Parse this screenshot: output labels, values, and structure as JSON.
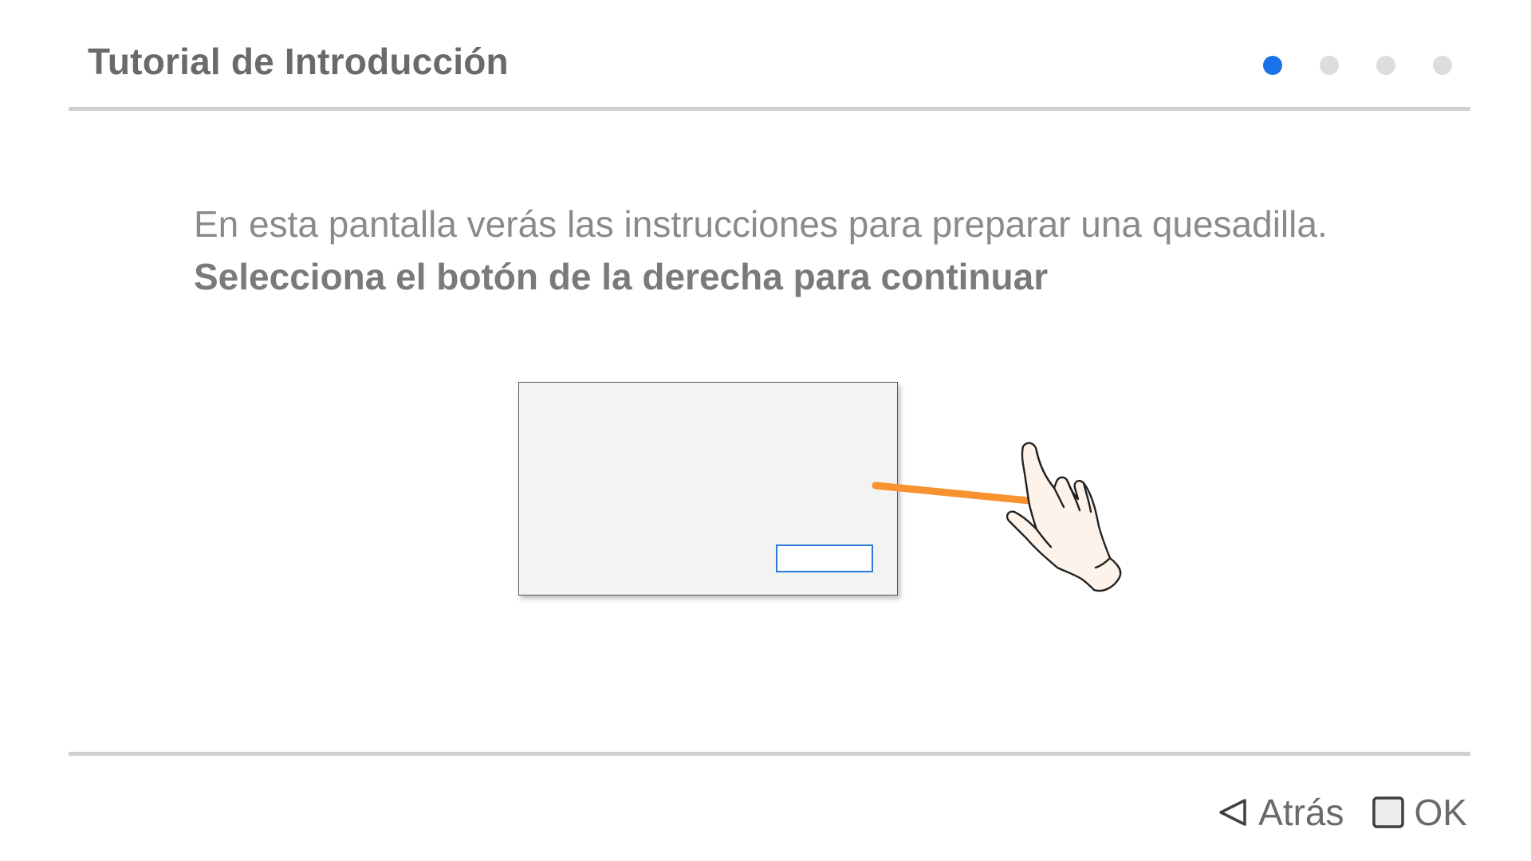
{
  "header": {
    "title": "Tutorial de Introducción",
    "steps": {
      "total": 4,
      "current": 1
    }
  },
  "instructions": {
    "line1": "En esta pantalla verás las instrucciones para preparar una quesadilla.",
    "line2": "Selecciona el botón de la derecha para continuar"
  },
  "illustration": {
    "pointer_color": "#f7922f",
    "hand_fill": "#fdf3ea",
    "button_border_color": "#2a7ad8",
    "icons": [
      "hand-pointer-icon"
    ]
  },
  "footer": {
    "back_label": "Atrás",
    "back_icon": "triangle-left-icon",
    "ok_label": "OK",
    "ok_icon": "square-icon"
  },
  "colors": {
    "accent": "#1a73e8",
    "inactive_dot": "#dddddd",
    "divider": "#cfcfcf"
  }
}
